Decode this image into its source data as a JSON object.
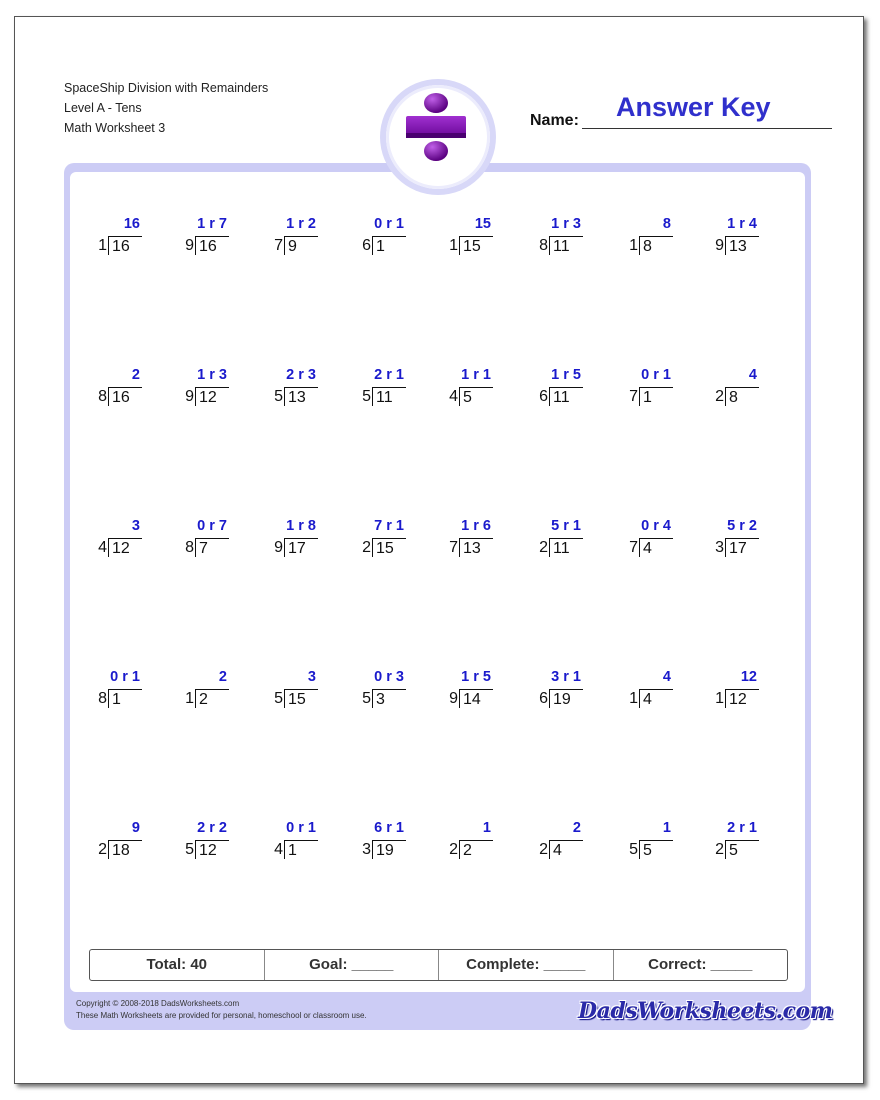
{
  "header": {
    "title": "SpaceShip Division with Remainders",
    "level": "Level A - Tens",
    "worksheet": "Math Worksheet 3",
    "name_label": "Name:",
    "answer_key": "Answer Key"
  },
  "logo": {
    "icon": "division-sign-icon",
    "color": "#7a0fa8"
  },
  "colors": {
    "answer": "#1a1acc",
    "frame": "#ccccf5",
    "answer_key": "#3030cc"
  },
  "problems": [
    [
      {
        "divisor": "1",
        "dividend": "16",
        "answer": "16"
      },
      {
        "divisor": "9",
        "dividend": "16",
        "answer": "1 r 7"
      },
      {
        "divisor": "7",
        "dividend": "9",
        "answer": "1 r 2"
      },
      {
        "divisor": "6",
        "dividend": "1",
        "answer": "0 r 1"
      },
      {
        "divisor": "1",
        "dividend": "15",
        "answer": "15"
      },
      {
        "divisor": "8",
        "dividend": "11",
        "answer": "1 r 3"
      },
      {
        "divisor": "1",
        "dividend": "8",
        "answer": "8"
      },
      {
        "divisor": "9",
        "dividend": "13",
        "answer": "1 r 4"
      }
    ],
    [
      {
        "divisor": "8",
        "dividend": "16",
        "answer": "2"
      },
      {
        "divisor": "9",
        "dividend": "12",
        "answer": "1 r 3"
      },
      {
        "divisor": "5",
        "dividend": "13",
        "answer": "2 r 3"
      },
      {
        "divisor": "5",
        "dividend": "11",
        "answer": "2 r 1"
      },
      {
        "divisor": "4",
        "dividend": "5",
        "answer": "1 r 1"
      },
      {
        "divisor": "6",
        "dividend": "11",
        "answer": "1 r 5"
      },
      {
        "divisor": "7",
        "dividend": "1",
        "answer": "0 r 1"
      },
      {
        "divisor": "2",
        "dividend": "8",
        "answer": "4"
      }
    ],
    [
      {
        "divisor": "4",
        "dividend": "12",
        "answer": "3"
      },
      {
        "divisor": "8",
        "dividend": "7",
        "answer": "0 r 7"
      },
      {
        "divisor": "9",
        "dividend": "17",
        "answer": "1 r 8"
      },
      {
        "divisor": "2",
        "dividend": "15",
        "answer": "7 r 1"
      },
      {
        "divisor": "7",
        "dividend": "13",
        "answer": "1 r 6"
      },
      {
        "divisor": "2",
        "dividend": "11",
        "answer": "5 r 1"
      },
      {
        "divisor": "7",
        "dividend": "4",
        "answer": "0 r 4"
      },
      {
        "divisor": "3",
        "dividend": "17",
        "answer": "5 r 2"
      }
    ],
    [
      {
        "divisor": "8",
        "dividend": "1",
        "answer": "0 r 1"
      },
      {
        "divisor": "1",
        "dividend": "2",
        "answer": "2"
      },
      {
        "divisor": "5",
        "dividend": "15",
        "answer": "3"
      },
      {
        "divisor": "5",
        "dividend": "3",
        "answer": "0 r 3"
      },
      {
        "divisor": "9",
        "dividend": "14",
        "answer": "1 r 5"
      },
      {
        "divisor": "6",
        "dividend": "19",
        "answer": "3 r 1"
      },
      {
        "divisor": "1",
        "dividend": "4",
        "answer": "4"
      },
      {
        "divisor": "1",
        "dividend": "12",
        "answer": "12"
      }
    ],
    [
      {
        "divisor": "2",
        "dividend": "18",
        "answer": "9"
      },
      {
        "divisor": "5",
        "dividend": "12",
        "answer": "2 r 2"
      },
      {
        "divisor": "4",
        "dividend": "1",
        "answer": "0 r 1"
      },
      {
        "divisor": "3",
        "dividend": "19",
        "answer": "6 r 1"
      },
      {
        "divisor": "2",
        "dividend": "2",
        "answer": "1"
      },
      {
        "divisor": "2",
        "dividend": "4",
        "answer": "2"
      },
      {
        "divisor": "5",
        "dividend": "5",
        "answer": "1"
      },
      {
        "divisor": "2",
        "dividend": "5",
        "answer": "2 r 1"
      }
    ]
  ],
  "stats": {
    "total": "Total: 40",
    "goal": "Goal: _____",
    "complete": "Complete: _____",
    "correct": "Correct: _____"
  },
  "footer": {
    "copyright": "Copyright © 2008-2018 DadsWorksheets.com",
    "note": "These Math Worksheets are provided for personal, homeschool or classroom use.",
    "brand": "DadsWorksheets.com"
  }
}
